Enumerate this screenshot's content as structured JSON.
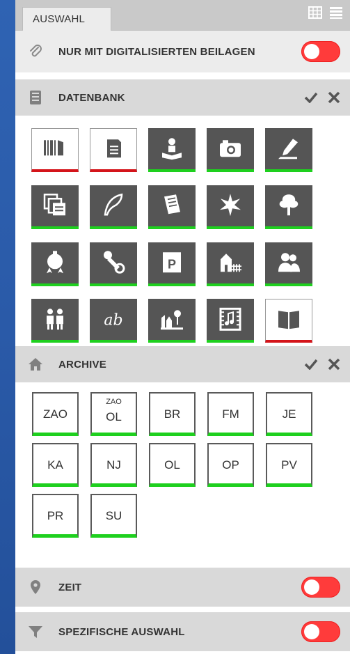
{
  "tabs": [
    {
      "label": "AUSWAHL",
      "active": true
    }
  ],
  "toolbar": {
    "icons": [
      "grid-view-icon",
      "list-view-icon"
    ]
  },
  "digital": {
    "label": "NUR MIT DIGITALISIERTEN BEILAGEN",
    "toggle_on": false
  },
  "database": {
    "title": "DATENBANK",
    "icons": [
      "barcode-icon",
      "file-cabinet-icon",
      "reading-person-icon",
      "camera-icon",
      "pen-icon",
      "stacked-documents-icon",
      "feather-icon",
      "scroll-icon",
      "star-burst-icon",
      "tree-icon",
      "seal-icon",
      "stamp-icon",
      "poster-icon",
      "house-fence-icon",
      "people-icon",
      "children-icon",
      "handwriting-icon",
      "landscape-icon",
      "film-music-icon",
      "book-icon"
    ],
    "selected": [
      "barcode-icon",
      "file-cabinet-icon",
      "book-icon"
    ]
  },
  "archive": {
    "title": "ARCHIVE",
    "codes": [
      {
        "sup": "",
        "main": "ZAO"
      },
      {
        "sup": "ZAO",
        "main": "OL"
      },
      {
        "sup": "",
        "main": "BR"
      },
      {
        "sup": "",
        "main": "FM"
      },
      {
        "sup": "",
        "main": "JE"
      },
      {
        "sup": "",
        "main": "KA"
      },
      {
        "sup": "",
        "main": "NJ"
      },
      {
        "sup": "",
        "main": "OL"
      },
      {
        "sup": "",
        "main": "OP"
      },
      {
        "sup": "",
        "main": "PV"
      },
      {
        "sup": "",
        "main": "PR"
      },
      {
        "sup": "",
        "main": "SU"
      }
    ]
  },
  "time": {
    "label": "ZEIT",
    "toggle_on": false
  },
  "specific": {
    "label": "SPEZIFISCHE AUSWAHL",
    "toggle_on": false
  },
  "colors": {
    "toggle_off": "#ff3b3b",
    "active_bar": "#1ed01e",
    "selected_bar": "#d4141a",
    "tile_bg": "#555555"
  }
}
